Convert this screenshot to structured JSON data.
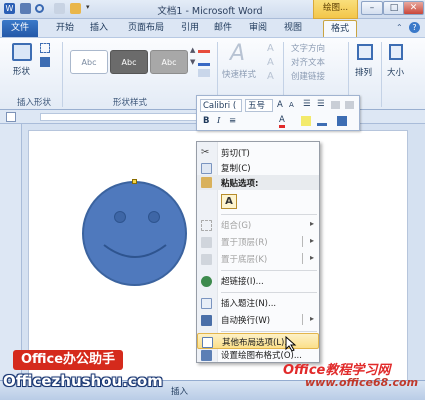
{
  "window": {
    "title": "文档1 - Microsoft Word",
    "context_tools_label": "绘图..."
  },
  "tabs": [
    "文件",
    "开始",
    "插入",
    "页面布局",
    "引用",
    "邮件",
    "审阅",
    "视图",
    "格式"
  ],
  "ribbon": {
    "group_insert_shapes": "插入形状",
    "shapes_label": "形状",
    "style_samples": [
      "Abc",
      "Abc",
      "Abc"
    ],
    "group_shape_styles": "形状样式",
    "quick_styles": "快速样式",
    "text_direction": "文字方向",
    "align_text": "对齐文本",
    "create_link": "创建链接",
    "arrange": "排列",
    "size": "大小"
  },
  "mini_toolbar": {
    "font_name": "Calibri (",
    "font_size": "五号",
    "bold": "B",
    "italic": "I",
    "font_color_letter": "A"
  },
  "context_menu": {
    "cut": "剪切(T)",
    "copy": "复制(C)",
    "paste_options": "粘贴选项:",
    "paste_keep_icon": "A",
    "group": "组合(G)",
    "bring_front": "置于顶层(R)",
    "send_back": "置于底层(K)",
    "hyperlink": "超链接(I)...",
    "insert_caption": "插入题注(N)...",
    "wrap_text": "自动换行(W)",
    "more_layout": "其他布局选项(L)...",
    "format_shape": "设置绘图布格式(O)..."
  },
  "statusbar": {
    "insert_mode": "插入"
  },
  "watermarks": {
    "badge": "Office办公助手",
    "url_left": "Officezhushou.com",
    "brand_right": "Office教程学习网",
    "url_right": "www.office68.com"
  },
  "colors": {
    "shape_fill": "#4f79bd",
    "file_tab": "#2b62b4",
    "highlight": "#fbdf8a"
  }
}
